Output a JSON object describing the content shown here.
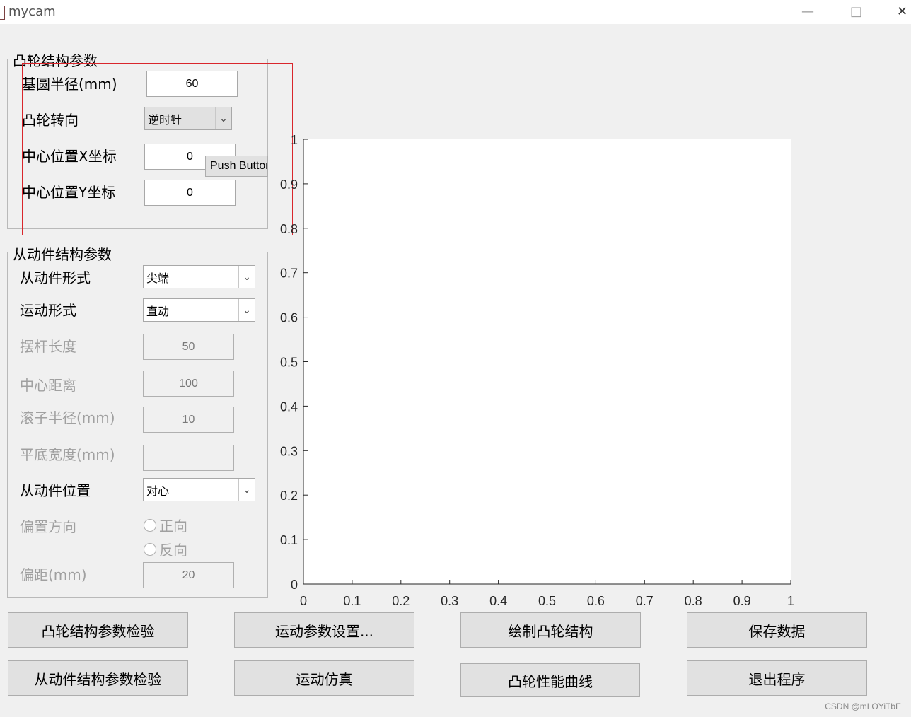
{
  "window": {
    "title": "mycam",
    "minimize_glyph": "—",
    "maximize_glyph": "□",
    "close_glyph": "✕"
  },
  "cam_panel": {
    "title": "凸轮结构参数",
    "base_radius_label": "基圆半径(mm)",
    "base_radius_value": "60",
    "rotation_label": "凸轮转向",
    "rotation_value": "逆时针",
    "center_x_label": "中心位置X坐标",
    "center_x_value": "0",
    "center_y_label": "中心位置Y坐标",
    "center_y_value": "0",
    "push_button_label": "Push Button"
  },
  "follower_panel": {
    "title": "从动件结构参数",
    "form_label": "从动件形式",
    "form_value": "尖端",
    "motion_label": "运动形式",
    "motion_value": "直动",
    "rocker_length_label": "摆杆长度",
    "rocker_length_value": "50",
    "center_distance_label": "中心距离",
    "center_distance_value": "100",
    "roller_radius_label": "滚子半径(mm)",
    "roller_radius_value": "10",
    "flat_width_label": "平底宽度(mm)",
    "flat_width_value": "",
    "position_label": "从动件位置",
    "position_value": "对心",
    "offset_dir_label": "偏置方向",
    "offset_dir_options": [
      "正向",
      "反向"
    ],
    "offset_label": "偏距(mm)",
    "offset_value": "20"
  },
  "axes": {
    "x_ticks": [
      "0",
      "0.1",
      "0.2",
      "0.3",
      "0.4",
      "0.5",
      "0.6",
      "0.7",
      "0.8",
      "0.9",
      "1"
    ],
    "y_ticks": [
      "0",
      "0.1",
      "0.2",
      "0.3",
      "0.4",
      "0.5",
      "0.6",
      "0.7",
      "0.8",
      "0.9",
      "1"
    ]
  },
  "chart_data": {
    "type": "line",
    "series": [],
    "xlim": [
      0,
      1
    ],
    "ylim": [
      0,
      1
    ],
    "grid": false
  },
  "buttons": {
    "check_cam": "凸轮结构参数检验",
    "motion_settings": "运动参数设置...",
    "draw_cam": "绘制凸轮结构",
    "save_data": "保存数据",
    "check_follower": "从动件结构参数检验",
    "simulate": "运动仿真",
    "performance_curve": "凸轮性能曲线",
    "exit": "退出程序"
  },
  "watermark": "CSDN @mLOYiTbE"
}
